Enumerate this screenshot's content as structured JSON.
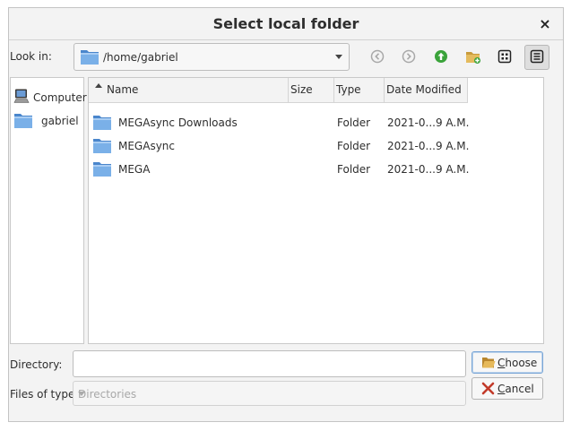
{
  "window": {
    "title": "Select local folder",
    "close_glyph": "×"
  },
  "lookin": {
    "label": "Look in:",
    "path": "/home/gabriel"
  },
  "toolbar": {
    "back_icon": "back-icon",
    "forward_icon": "forward-icon",
    "parent_icon": "parent-directory-icon",
    "new_folder_icon": "new-folder-icon",
    "list_view_icon": "list-view-icon",
    "detail_view_icon": "detail-view-icon",
    "active_view": "detail"
  },
  "sidebar": {
    "items": [
      {
        "label": "Computer",
        "icon": "computer-icon"
      },
      {
        "label": "gabriel",
        "icon": "folder-icon"
      }
    ]
  },
  "filelist": {
    "columns": [
      "Name",
      "Size",
      "Type",
      "Date Modified"
    ],
    "sort_column": "Name",
    "sort_order": "ascending",
    "rows": [
      {
        "name": "MEGAsync Downloads",
        "size": "",
        "type": "Folder",
        "date": "2021-0...9 A.M."
      },
      {
        "name": "MEGAsync",
        "size": "",
        "type": "Folder",
        "date": "2021-0...9 A.M."
      },
      {
        "name": "MEGA",
        "size": "",
        "type": "Folder",
        "date": "2021-0...9 A.M."
      }
    ]
  },
  "directory": {
    "label": "Directory:",
    "value": ""
  },
  "files_of_type": {
    "label": "Files of type:",
    "value": "Directories"
  },
  "buttons": {
    "choose": "Choose",
    "cancel": "Cancel"
  },
  "colors": {
    "folder_fill": "#6fa6e0",
    "folder_dark": "#4a86cc",
    "parent_green": "#3aa33a",
    "cancel_red": "#c23a2a"
  }
}
